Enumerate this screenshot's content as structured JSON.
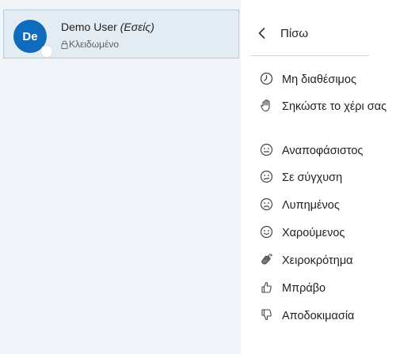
{
  "user": {
    "initials": "De",
    "name": "Demo User",
    "you_tag": "(Εσείς)",
    "status": "Κλειδωμένο",
    "avatar_color": "#0f6cbd"
  },
  "menu": {
    "back_label": "Πίσω",
    "items": [
      {
        "label": "Μη διαθέσιμος",
        "icon": "clock-icon"
      },
      {
        "label": "Σηκώστε το χέρι σας",
        "icon": "raised-hand-icon"
      },
      {
        "label": "Αναποφάσιστος",
        "icon": "neutral-face-icon"
      },
      {
        "label": "Σε σύγχυση",
        "icon": "confused-face-icon"
      },
      {
        "label": "Λυπημένος",
        "icon": "sad-face-icon"
      },
      {
        "label": "Χαρούμενος",
        "icon": "happy-face-icon"
      },
      {
        "label": "Χειροκρότημα",
        "icon": "clapping-hands-icon"
      },
      {
        "label": "Μπράβο",
        "icon": "thumbs-up-icon"
      },
      {
        "label": "Αποδοκιμασία",
        "icon": "thumbs-down-icon"
      }
    ]
  }
}
